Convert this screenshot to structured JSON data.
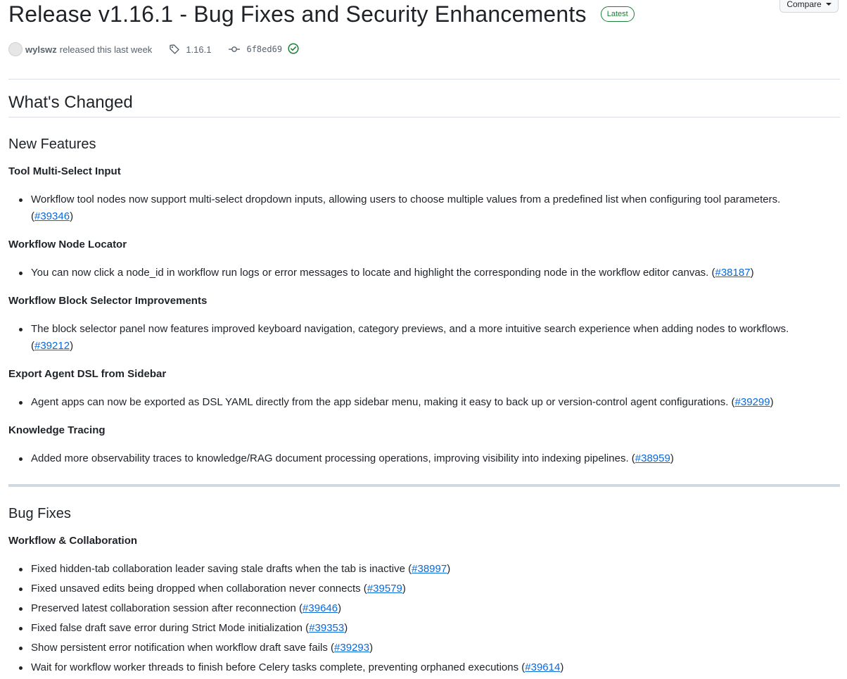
{
  "release": {
    "title": "Release v1.16.1 - Bug Fixes and Security Enhancements",
    "badge": "Latest",
    "compare_label": "Compare",
    "author": "wylswz",
    "released_text": "released this last week",
    "tag": "1.16.1",
    "commit": "6f8ed69"
  },
  "body": {
    "whats_changed": "What's Changed",
    "new_features": {
      "heading": "New Features",
      "sections": [
        {
          "title": "Tool Multi-Select Input",
          "items": [
            {
              "text": "Workflow tool nodes now support multi-select dropdown inputs, allowing users to choose multiple values from a predefined list when configuring tool parameters.",
              "pr": "#39346"
            }
          ]
        },
        {
          "title": "Workflow Node Locator",
          "items": [
            {
              "text": "You can now click a node_id in workflow run logs or error messages to locate and highlight the corresponding node in the workflow editor canvas.",
              "pr": "#38187"
            }
          ]
        },
        {
          "title": "Workflow Block Selector Improvements",
          "items": [
            {
              "text": "The block selector panel now features improved keyboard navigation, category previews, and a more intuitive search experience when adding nodes to workflows.",
              "pr": "#39212"
            }
          ]
        },
        {
          "title": "Export Agent DSL from Sidebar",
          "items": [
            {
              "text": "Agent apps can now be exported as DSL YAML directly from the app sidebar menu, making it easy to back up or version-control agent configurations.",
              "pr": "#39299"
            }
          ]
        },
        {
          "title": "Knowledge Tracing",
          "items": [
            {
              "text": "Added more observability traces to knowledge/RAG document processing operations, improving visibility into indexing pipelines.",
              "pr": "#38959"
            }
          ]
        }
      ]
    },
    "bug_fixes": {
      "heading": "Bug Fixes",
      "sections": [
        {
          "title": "Workflow & Collaboration",
          "items": [
            {
              "text": "Fixed hidden-tab collaboration leader saving stale drafts when the tab is inactive",
              "pr": "#38997"
            },
            {
              "text": "Fixed unsaved edits being dropped when collaboration never connects",
              "pr": "#39579"
            },
            {
              "text": "Preserved latest collaboration session after reconnection",
              "pr": "#39646"
            },
            {
              "text": "Fixed false draft save error during Strict Mode initialization",
              "pr": "#39353"
            },
            {
              "text": "Show persistent error notification when workflow draft save fails",
              "pr": "#39293"
            },
            {
              "text": "Wait for workflow worker threads to finish before Celery tasks complete, preventing orphaned executions",
              "pr": "#39614"
            }
          ]
        }
      ]
    }
  },
  "colors": {
    "link": "#0969da",
    "latest_badge": "#1a7f37",
    "verified": "#1a7f37"
  },
  "icons": [
    "tag-icon",
    "git-commit-icon",
    "verified-check-icon",
    "chevron-down-icon"
  ]
}
